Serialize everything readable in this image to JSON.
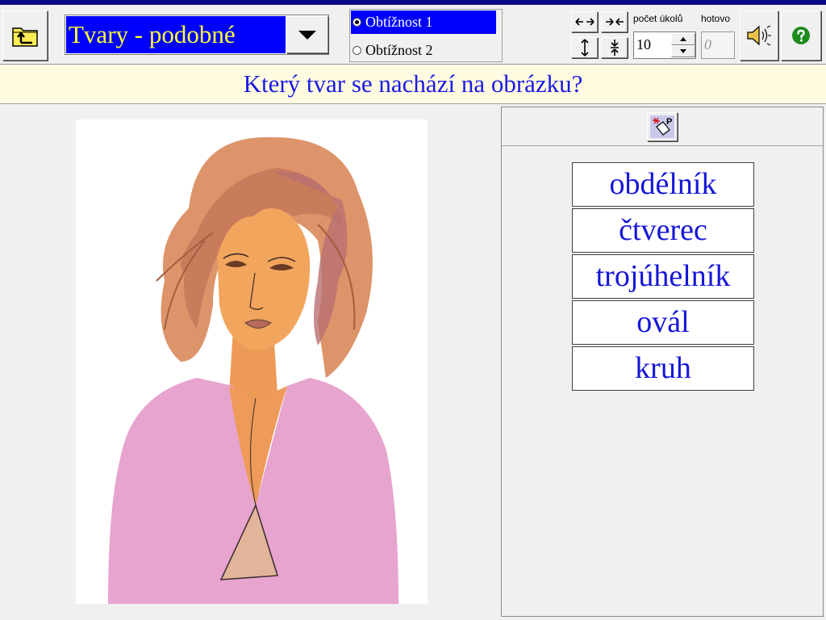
{
  "toolbar": {
    "activity": "Tvary - podobné",
    "difficulty_options": [
      "Obtížnost 1",
      "Obtížnost 2"
    ],
    "selected_difficulty": "Obtížnost 1",
    "task_count_label": "počet úkolů",
    "task_count": "10",
    "done_label": "hotovo",
    "done": "0"
  },
  "question": "Který tvar se nachází na obrázku?",
  "picture": {
    "subject": "woman-with-triangle-pendant"
  },
  "answers": [
    "obdélník",
    "čtverec",
    "trojúhelník",
    "ovál",
    "kruh"
  ],
  "colors": {
    "accent": "#0000ff",
    "activity_text": "#ffff33",
    "question_bg": "#fffbe0",
    "question_text": "#1a1ae6",
    "answer_text": "#1515d8"
  }
}
